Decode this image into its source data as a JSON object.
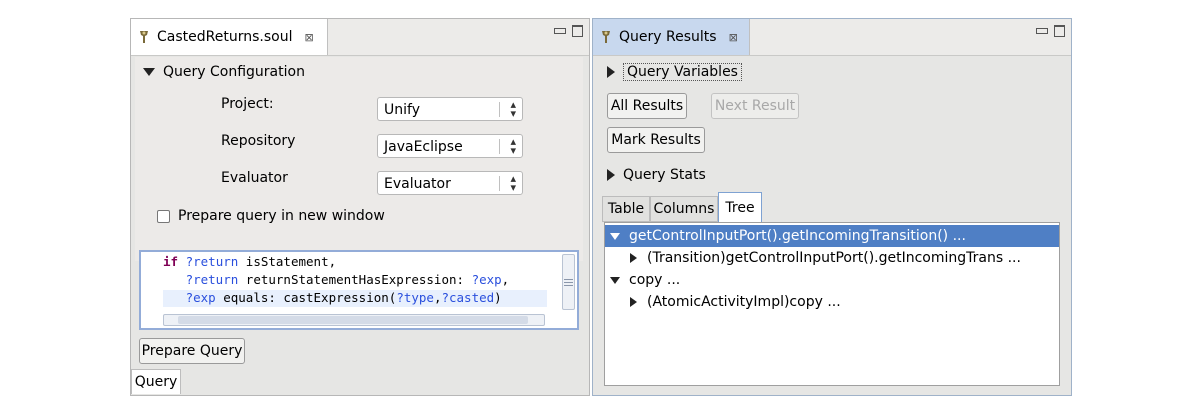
{
  "left": {
    "tab_title": "CastedReturns.soul",
    "tab_close": "⊠",
    "section_title": "Query Configuration",
    "fields": [
      {
        "label": "Project:",
        "value": "Unify"
      },
      {
        "label": "Repository",
        "value": "JavaEclipse"
      },
      {
        "label": "Evaluator",
        "value": "Evaluator"
      }
    ],
    "checkbox_label": "Prepare query in new window",
    "code_lines": [
      {
        "kw": "if",
        "var": "?return",
        "rest": " isStatement,",
        "var2": "",
        "rest2": ""
      },
      {
        "kw": "",
        "var": "?return",
        "rest": " returnStatementHasExpression: ",
        "var2": "?exp",
        "rest2": ","
      },
      {
        "kw": "",
        "var": "?exp",
        "rest": " equals: castExpression(",
        "var2": "?type",
        "rest2": ",",
        "var3": "?casted",
        "rest3": ")"
      }
    ],
    "prepare_button": "Prepare Query",
    "bottom_tab": "Query"
  },
  "right": {
    "tab_title": "Query Results",
    "tab_close": "⊠",
    "query_variables": "Query Variables",
    "all_results": "All Results",
    "next_result": "Next Result",
    "mark_results": "Mark Results",
    "query_stats": "Query Stats",
    "tabs": [
      "Table",
      "Columns",
      "Tree"
    ],
    "tree": [
      {
        "text": "getControlInputPort().getIncomingTransition() ...",
        "level": 0,
        "expanded": true,
        "selected": true
      },
      {
        "text": "(Transition)getControlInputPort().getIncomingTrans ...",
        "level": 1,
        "expanded": false,
        "selected": false
      },
      {
        "text": "copy ...",
        "level": 0,
        "expanded": true,
        "selected": false
      },
      {
        "text": "(AtomicActivityImpl)copy ...",
        "level": 1,
        "expanded": false,
        "selected": false
      }
    ]
  }
}
